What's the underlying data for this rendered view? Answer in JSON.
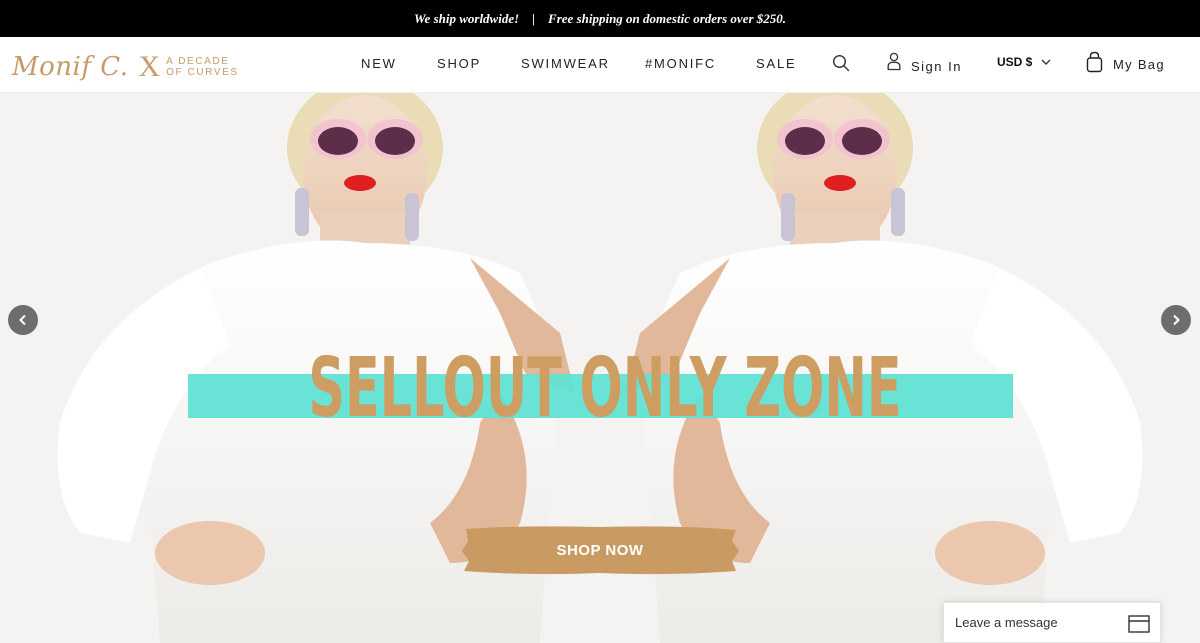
{
  "announcement": {
    "left": "We ship worldwide!",
    "separator": "|",
    "right": "Free shipping on domestic orders over $250."
  },
  "header": {
    "logo": {
      "script": "Monif C.",
      "x": "X",
      "tag_line1": "A DECADE",
      "tag_line2": "OF CURVES"
    },
    "nav": [
      {
        "label": "NEW"
      },
      {
        "label": "SHOP"
      },
      {
        "label": "SWIMWEAR"
      },
      {
        "label": "#MONIFC"
      },
      {
        "label": "SALE"
      }
    ],
    "icons": {
      "search": "search-icon",
      "account": "user-icon",
      "bag": "shopping-bag-icon",
      "currency_dropdown": "chevron-down-icon"
    },
    "sign_in_label": "Sign In",
    "currency_label": "USD $",
    "bag_label": "My Bag"
  },
  "hero": {
    "headline": "SELLOUT ONLY ZONE",
    "cta_label": "SHOP NOW",
    "icons": {
      "prev": "chevron-left-icon",
      "next": "chevron-right-icon"
    },
    "colors": {
      "headline": "#cd9d62",
      "band": "#60e2d3",
      "cta": "#c99a62"
    }
  },
  "chat": {
    "label": "Leave a message",
    "icon": "chat-window-icon"
  }
}
